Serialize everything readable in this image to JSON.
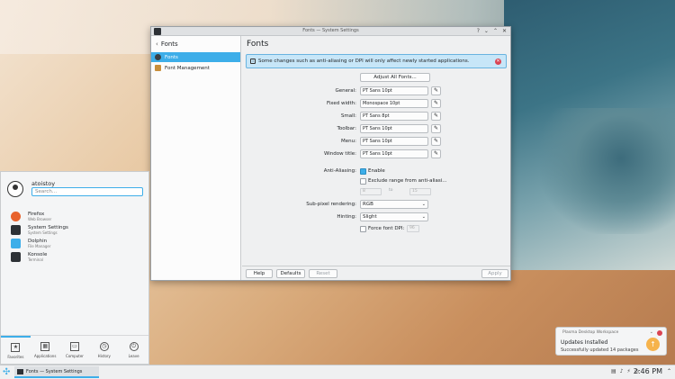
{
  "window": {
    "title": "Fonts — System Settings",
    "help_btn": "?",
    "min_btn": "⌄",
    "max_btn": "⌃",
    "close_btn": "✕"
  },
  "sidebar": {
    "back_label": "Fonts",
    "items": [
      {
        "label": "Fonts"
      },
      {
        "label": "Font Management"
      }
    ]
  },
  "content": {
    "title": "Fonts",
    "banner_text": "Some changes such as anti-aliasing or DPI will only affect newly started applications.",
    "adjust_all_label": "Adjust All Fonts...",
    "font_rows": [
      {
        "label": "General:",
        "value": "PT Sans 10pt"
      },
      {
        "label": "Fixed width:",
        "value": "Monospace 10pt"
      },
      {
        "label": "Small:",
        "value": "PT Sans 8pt"
      },
      {
        "label": "Toolbar:",
        "value": "PT Sans 10pt"
      },
      {
        "label": "Menu:",
        "value": "PT Sans 10pt"
      },
      {
        "label": "Window title:",
        "value": "PT Sans 10pt"
      }
    ],
    "anti_aliasing_label": "Anti-Aliasing:",
    "enable_label": "Enable",
    "exclude_label": "Exclude range from anti-aliasi...",
    "range_from": "8",
    "range_to_label": "to",
    "range_to": "15",
    "subpixel_label": "Sub-pixel rendering:",
    "subpixel_value": "RGB",
    "hinting_label": "Hinting:",
    "hinting_value": "Slight",
    "force_dpi_label": "Force font DPI:",
    "force_dpi_value": "96",
    "help_label": "Help",
    "defaults_label": "Defaults",
    "reset_label": "Reset",
    "apply_label": "Apply"
  },
  "launcher": {
    "username": "atoistoy",
    "search_placeholder": "Search...",
    "apps": [
      {
        "name": "Firefox",
        "desc": "Web Browser",
        "color": "#e8622c"
      },
      {
        "name": "System Settings",
        "desc": "System Settings",
        "color": "#2d3136"
      },
      {
        "name": "Dolphin",
        "desc": "File Manager",
        "color": "#3daee9"
      },
      {
        "name": "Konsole",
        "desc": "Terminal",
        "color": "#2d3136"
      }
    ],
    "tabs": [
      {
        "label": "Favorites",
        "icon": "★"
      },
      {
        "label": "Applications",
        "icon": "▦"
      },
      {
        "label": "Computer",
        "icon": "▭"
      },
      {
        "label": "History",
        "icon": "◷"
      },
      {
        "label": "Leave",
        "icon": "⏻"
      }
    ]
  },
  "notification": {
    "source": "Plasma Desktop Workspace",
    "title": "Updates Installed",
    "body": "Successfully updated 14 packages",
    "big_icon": "↑"
  },
  "taskbar": {
    "task_label": "Fonts — System Settings",
    "clock": "2:46 PM",
    "tray_icons": [
      "▤",
      "♪",
      "⚡",
      "◎"
    ]
  }
}
